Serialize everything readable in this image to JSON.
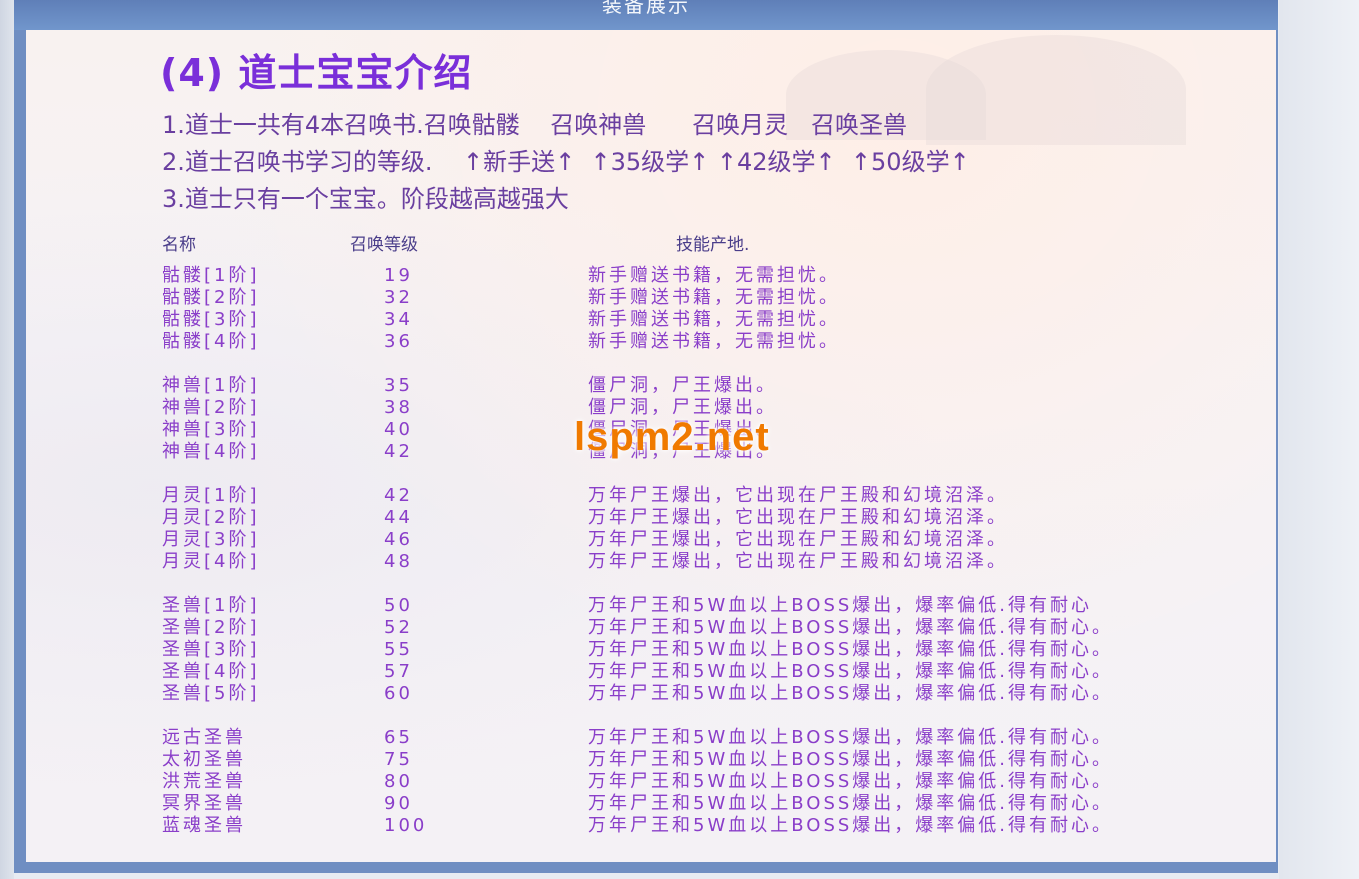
{
  "header": {
    "title": "装备展示"
  },
  "heading": "(4) 道士宝宝介绍",
  "intro": [
    "1.道士一共有4本召唤书.召唤骷髅    召唤神兽      召唤月灵   召唤圣兽",
    "2.道士召唤书学习的等级.    ↑新手送↑  ↑35级学↑ ↑42级学↑  ↑50级学↑",
    "3.道士只有一个宝宝。阶段越高越强大"
  ],
  "table": {
    "columns": [
      "名称",
      "召唤等级",
      "技能产地."
    ],
    "groups": [
      [
        {
          "name": "骷髅[1阶]",
          "level": "19",
          "source": "新手赠送书籍，无需担忧。"
        },
        {
          "name": "骷髅[2阶]",
          "level": "32",
          "source": "新手赠送书籍，无需担忧。"
        },
        {
          "name": "骷髅[3阶]",
          "level": "34",
          "source": "新手赠送书籍，无需担忧。"
        },
        {
          "name": "骷髅[4阶]",
          "level": "36",
          "source": "新手赠送书籍，无需担忧。"
        }
      ],
      [
        {
          "name": "神兽[1阶]",
          "level": "35",
          "source": "僵尸洞，尸王爆出。"
        },
        {
          "name": "神兽[2阶]",
          "level": "38",
          "source": "僵尸洞，尸王爆出。"
        },
        {
          "name": "神兽[3阶]",
          "level": "40",
          "source": "僵尸洞，尸王爆出。"
        },
        {
          "name": "神兽[4阶]",
          "level": "42",
          "source": "僵尸洞，尸王爆出。"
        }
      ],
      [
        {
          "name": "月灵[1阶]",
          "level": "42",
          "source": "万年尸王爆出，它出现在尸王殿和幻境沼泽。"
        },
        {
          "name": "月灵[2阶]",
          "level": "44",
          "source": "万年尸王爆出，它出现在尸王殿和幻境沼泽。"
        },
        {
          "name": "月灵[3阶]",
          "level": "46",
          "source": "万年尸王爆出，它出现在尸王殿和幻境沼泽。"
        },
        {
          "name": "月灵[4阶]",
          "level": "48",
          "source": "万年尸王爆出，它出现在尸王殿和幻境沼泽。"
        }
      ],
      [
        {
          "name": "圣兽[1阶]",
          "level": "50",
          "source": "万年尸王和5W血以上BOSS爆出，爆率偏低.得有耐心"
        },
        {
          "name": "圣兽[2阶]",
          "level": "52",
          "source": "万年尸王和5W血以上BOSS爆出，爆率偏低.得有耐心。"
        },
        {
          "name": "圣兽[3阶]",
          "level": "55",
          "source": "万年尸王和5W血以上BOSS爆出，爆率偏低.得有耐心。"
        },
        {
          "name": "圣兽[4阶]",
          "level": "57",
          "source": "万年尸王和5W血以上BOSS爆出，爆率偏低.得有耐心。"
        },
        {
          "name": "圣兽[5阶]",
          "level": "60",
          "source": "万年尸王和5W血以上BOSS爆出，爆率偏低.得有耐心。"
        }
      ],
      [
        {
          "name": "远古圣兽",
          "level": "65",
          "source": "万年尸王和5W血以上BOSS爆出，爆率偏低.得有耐心。"
        },
        {
          "name": "太初圣兽",
          "level": "75",
          "source": "万年尸王和5W血以上BOSS爆出，爆率偏低.得有耐心。"
        },
        {
          "name": "洪荒圣兽",
          "level": "80",
          "source": "万年尸王和5W血以上BOSS爆出，爆率偏低.得有耐心。"
        },
        {
          "name": "冥界圣兽",
          "level": "90",
          "source": "万年尸王和5W血以上BOSS爆出，爆率偏低.得有耐心。"
        },
        {
          "name": "蓝魂圣兽",
          "level": "100",
          "source": "万年尸王和5W血以上BOSS爆出，爆率偏低.得有耐心。"
        }
      ]
    ]
  },
  "watermark": "lspm2.net",
  "colors": {
    "heading": "#7a2fd9",
    "rows": "#8a3ec9",
    "frame": "#6f8ec2",
    "watermark": "#f07a00"
  }
}
